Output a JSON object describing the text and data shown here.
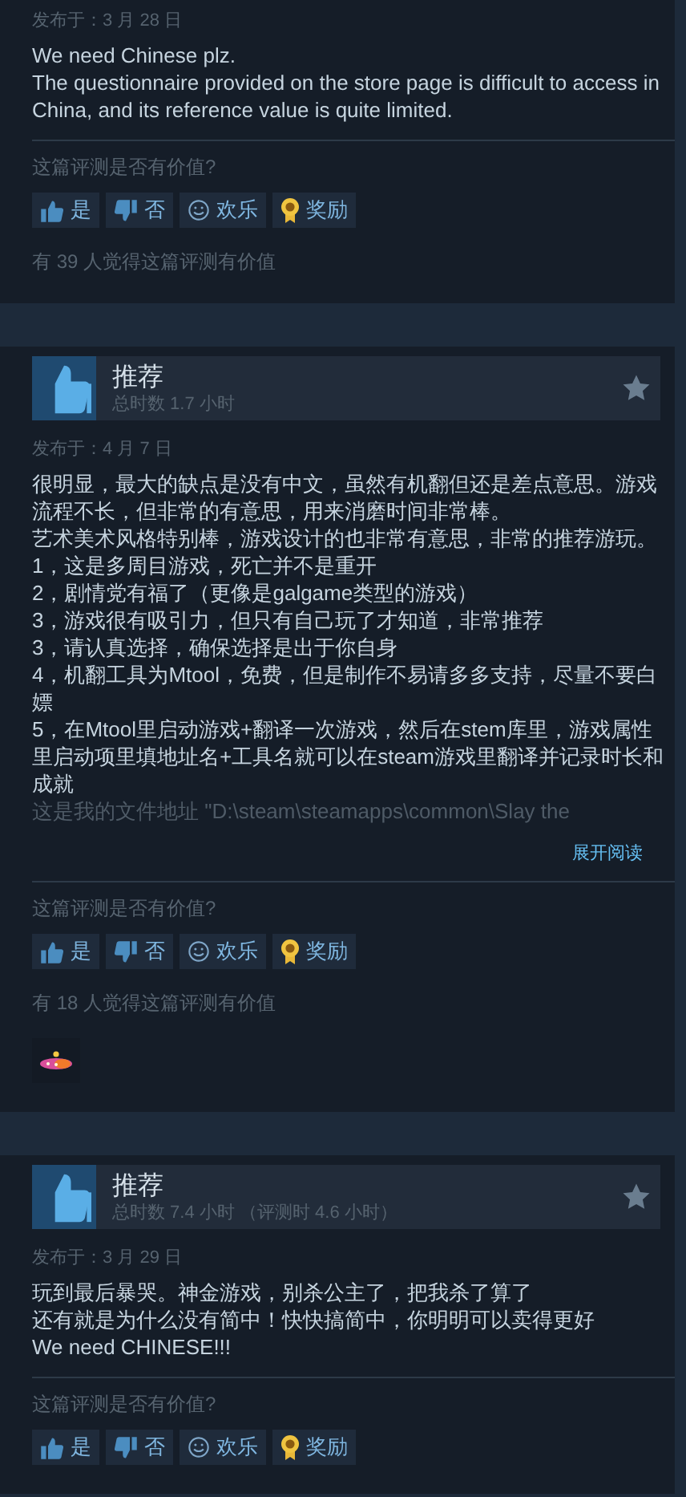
{
  "reviews": [
    {
      "posted": "发布于：3 月 28 日",
      "paragraphs": [
        {
          "text": "We need Chinese plz.",
          "faded": false
        },
        {
          "text": "The questionnaire provided on the store page is difficult to access in China, and its reference value is quite limited.",
          "faded": false
        }
      ],
      "helpful_prompt": "这篇评测是否有价值?",
      "votes": [
        {
          "kind": "up",
          "label": "是"
        },
        {
          "kind": "down",
          "label": "否"
        },
        {
          "kind": "funny",
          "label": "欢乐"
        },
        {
          "kind": "award",
          "label": "奖励"
        }
      ],
      "helpful_count": "有 39 人觉得这篇评测有价值"
    },
    {
      "header": {
        "verdict": "推荐",
        "hours": "总时数 1.7 小时"
      },
      "posted": "发布于：4 月 7 日",
      "paragraphs": [
        {
          "text": "很明显，最大的缺点是没有中文，虽然有机翻但还是差点意思。游戏流程不长，但非常的有意思，用来消磨时间非常棒。",
          "faded": false
        },
        {
          "text": "艺术美术风格特别棒，游戏设计的也非常有意思，非常的推荐游玩。",
          "faded": false
        },
        {
          "text": "1，这是多周目游戏，死亡并不是重开",
          "faded": false
        },
        {
          "text": "2，剧情党有福了（更像是galgame类型的游戏）",
          "faded": false
        },
        {
          "text": "3，游戏很有吸引力，但只有自己玩了才知道，非常推荐",
          "faded": false
        },
        {
          "text": "3，请认真选择，确保选择是出于你自身",
          "faded": false
        },
        {
          "text": "4，机翻工具为Mtool，免费，但是制作不易请多多支持，尽量不要白嫖",
          "faded": false
        },
        {
          "text": "5，在Mtool里启动游戏+翻译一次游戏，然后在stem库里，游戏属性里启动项里填地址名+工具名就可以在steam游戏里翻译并记录时长和成就",
          "faded": false
        },
        {
          "text": "这是我的文件地址 \"D:\\steam\\steamapps\\common\\Slay the",
          "faded": true
        }
      ],
      "more_link": "展开阅读",
      "helpful_prompt": "这篇评测是否有价值?",
      "votes": [
        {
          "kind": "up",
          "label": "是"
        },
        {
          "kind": "down",
          "label": "否"
        },
        {
          "kind": "funny",
          "label": "欢乐"
        },
        {
          "kind": "award",
          "label": "奖励"
        }
      ],
      "helpful_count": "有 18 人觉得这篇评测有价值",
      "awards": [
        {
          "kind": "saucer"
        }
      ]
    },
    {
      "header": {
        "verdict": "推荐",
        "hours": "总时数 7.4 小时 （评测时 4.6 小时）"
      },
      "posted": "发布于：3 月 29 日",
      "paragraphs": [
        {
          "text": "玩到最后暴哭。神金游戏，别杀公主了，把我杀了算了",
          "faded": false
        },
        {
          "text": "还有就是为什么没有简中！快快搞简中，你明明可以卖得更好",
          "faded": false
        },
        {
          "text": "We need CHINESE!!!",
          "faded": false
        }
      ],
      "helpful_prompt": "这篇评测是否有价值?",
      "votes": [
        {
          "kind": "up",
          "label": "是"
        },
        {
          "kind": "down",
          "label": "否"
        },
        {
          "kind": "funny",
          "label": "欢乐"
        },
        {
          "kind": "award",
          "label": "奖励"
        }
      ]
    }
  ]
}
